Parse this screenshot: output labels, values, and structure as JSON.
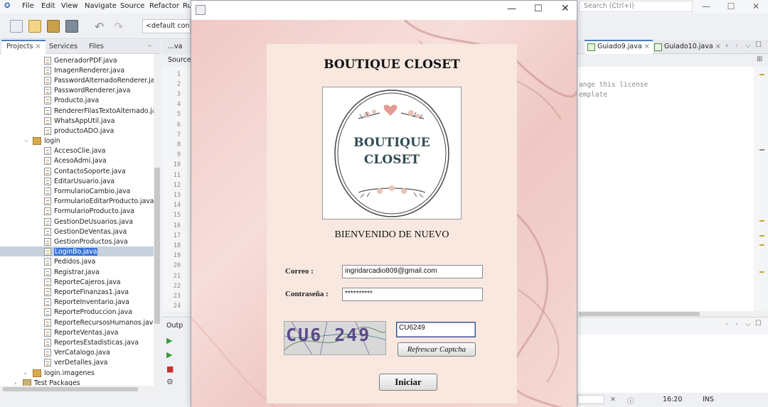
{
  "ide": {
    "menu": [
      "File",
      "Edit",
      "View",
      "Navigate",
      "Source",
      "Refactor",
      "Ru"
    ],
    "search_placeholder": "Search (Ctrl+I)",
    "config_dropdown": "<default config",
    "project_tabs": [
      "Projects",
      "Services",
      "Files"
    ],
    "tree_items": [
      "GeneradorPDF.java",
      "ImagenRenderer.java",
      "PasswordAlternadoRenderer.java",
      "PasswordRenderer.java",
      "Producto.java",
      "RendererFilasTextoAlternado.java",
      "WhatsAppUtil.java",
      "productoADO.java"
    ],
    "login_package": "login",
    "login_items": [
      "AccesoClie.java",
      "AcesoAdmi.java",
      "ContactoSoporte.java",
      "EditarUsuario.java",
      "FormularioCambio.java",
      "FormularioEditarProducto.java",
      "FormularioProducto.java",
      "GestionDeUsuarios.java",
      "GestionDeVentas.java",
      "GestionProductos.java",
      "LoginBo.java",
      "Pedidos.java",
      "Registrar.java",
      "ReporteCajeros.java",
      "ReporteFinanzas1.java",
      "ReporteInventario.java",
      "ReporteProduccion.java",
      "ReporteRecursosHumanos.java",
      "ReporteVentas.java",
      "ReportesEstadisticas.java",
      "VerCatalogo.java",
      "verDetalles.java"
    ],
    "selected_item": "LoginBo.java",
    "images_package": "login.imagenes",
    "test_packages": "Test Packages",
    "left_editor_tab": "...va",
    "source_tab": "Source",
    "line_numbers": [
      "1",
      "2",
      "3",
      "4",
      "5",
      "6",
      "7",
      "8",
      "9",
      "10",
      "11",
      "12",
      "13",
      "14",
      "15",
      "16",
      "17",
      "18",
      "19",
      "20",
      "21",
      "22",
      "23",
      "24"
    ],
    "output_tab": "Outp",
    "right_tabs": [
      "Guiado9.java",
      "Guiado10.java"
    ],
    "code_lines": [
      "ange this license",
      "emplate"
    ],
    "status": {
      "position": "16:20",
      "mode": "INS"
    }
  },
  "login": {
    "shop_title": "BOUTIQUE CLOSET",
    "logo_line1": "BOUTIQUE",
    "logo_line2": "CLOSET",
    "welcome": "BIENVENIDO DE NUEVO",
    "email_label": "Correo :",
    "email_value": "ingridarcadio809@gmail.com",
    "password_label": "Contraseña :",
    "password_value": "**********",
    "captcha_image_text": "CU6 249",
    "captcha_input": "CU6249",
    "refresh_button": "Refrescar Captcha",
    "login_button": "Iniciar"
  },
  "colors": {
    "accent": "#3875d7",
    "window_bg": "#f0c9c6",
    "card_bg": "#f8e8e0"
  }
}
